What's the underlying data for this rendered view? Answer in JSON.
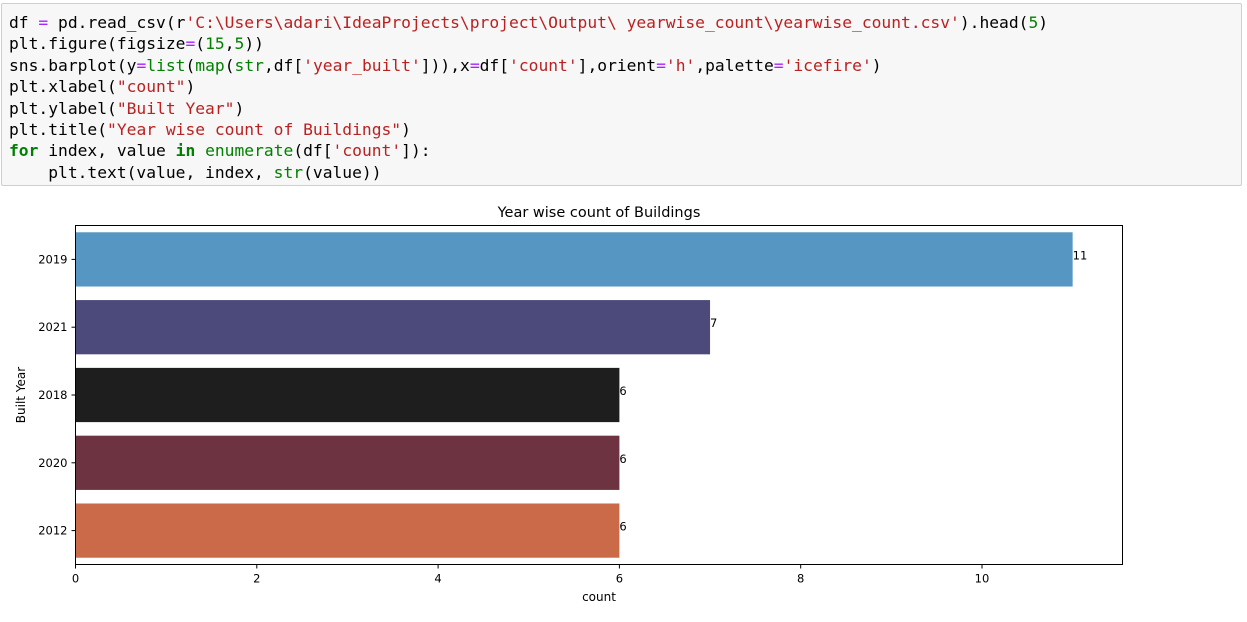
{
  "code_cell": {
    "lines": [
      [
        {
          "t": "df "
        },
        {
          "t": "=",
          "c": "op"
        },
        {
          "t": " pd.read_csv(r"
        },
        {
          "t": "'C:\\Users\\adari\\IdeaProjects\\project\\Output\\ yearwise_count\\yearwise_count.csv'",
          "c": "st"
        },
        {
          "t": ").head("
        },
        {
          "t": "5",
          "c": "nu"
        },
        {
          "t": ")"
        }
      ],
      [
        {
          "t": "plt.figure(figsize"
        },
        {
          "t": "=",
          "c": "op"
        },
        {
          "t": "("
        },
        {
          "t": "15",
          "c": "nu"
        },
        {
          "t": ","
        },
        {
          "t": "5",
          "c": "nu"
        },
        {
          "t": "))"
        }
      ],
      [
        {
          "t": "sns.barplot(y"
        },
        {
          "t": "=",
          "c": "op"
        },
        {
          "t": "list",
          "c": "bi"
        },
        {
          "t": "("
        },
        {
          "t": "map",
          "c": "bi"
        },
        {
          "t": "("
        },
        {
          "t": "str",
          "c": "bi"
        },
        {
          "t": ",df["
        },
        {
          "t": "'year_built'",
          "c": "st"
        },
        {
          "t": "])),x"
        },
        {
          "t": "=",
          "c": "op"
        },
        {
          "t": "df["
        },
        {
          "t": "'count'",
          "c": "st"
        },
        {
          "t": "],orient"
        },
        {
          "t": "=",
          "c": "op"
        },
        {
          "t": "'h'",
          "c": "st"
        },
        {
          "t": ",palette"
        },
        {
          "t": "=",
          "c": "op"
        },
        {
          "t": "'icefire'",
          "c": "st"
        },
        {
          "t": ")"
        }
      ],
      [
        {
          "t": "plt.xlabel("
        },
        {
          "t": "\"count\"",
          "c": "st"
        },
        {
          "t": ")"
        }
      ],
      [
        {
          "t": "plt.ylabel("
        },
        {
          "t": "\"Built Year\"",
          "c": "st"
        },
        {
          "t": ")"
        }
      ],
      [
        {
          "t": "plt.title("
        },
        {
          "t": "\"Year wise count of Buildings\"",
          "c": "st"
        },
        {
          "t": ")"
        }
      ],
      [
        {
          "t": "for",
          "c": "kw"
        },
        {
          "t": " index, value "
        },
        {
          "t": "in",
          "c": "kw"
        },
        {
          "t": " "
        },
        {
          "t": "enumerate",
          "c": "bi"
        },
        {
          "t": "(df["
        },
        {
          "t": "'count'",
          "c": "st"
        },
        {
          "t": "]):"
        }
      ],
      [
        {
          "t": "    plt.text(value, index, "
        },
        {
          "t": "str",
          "c": "bi"
        },
        {
          "t": "(value))"
        }
      ]
    ]
  },
  "chart_data": {
    "type": "bar",
    "orientation": "horizontal",
    "title": "Year wise count of Buildings",
    "xlabel": "count",
    "ylabel": "Built Year",
    "categories": [
      "2019",
      "2021",
      "2018",
      "2020",
      "2012"
    ],
    "values": [
      11,
      7,
      6,
      6,
      6
    ],
    "colors": [
      "#5596c2",
      "#4b4a7b",
      "#1e1e1e",
      "#6e3340",
      "#cb6a48"
    ],
    "value_labels": [
      "11",
      "7",
      "6",
      "6",
      "6"
    ],
    "xlim": [
      0,
      11.55
    ],
    "xticks": [
      0,
      2,
      4,
      6,
      8,
      10
    ],
    "xtick_labels": [
      "0",
      "2",
      "4",
      "6",
      "8",
      "10"
    ],
    "grid": false,
    "legend": "none"
  }
}
